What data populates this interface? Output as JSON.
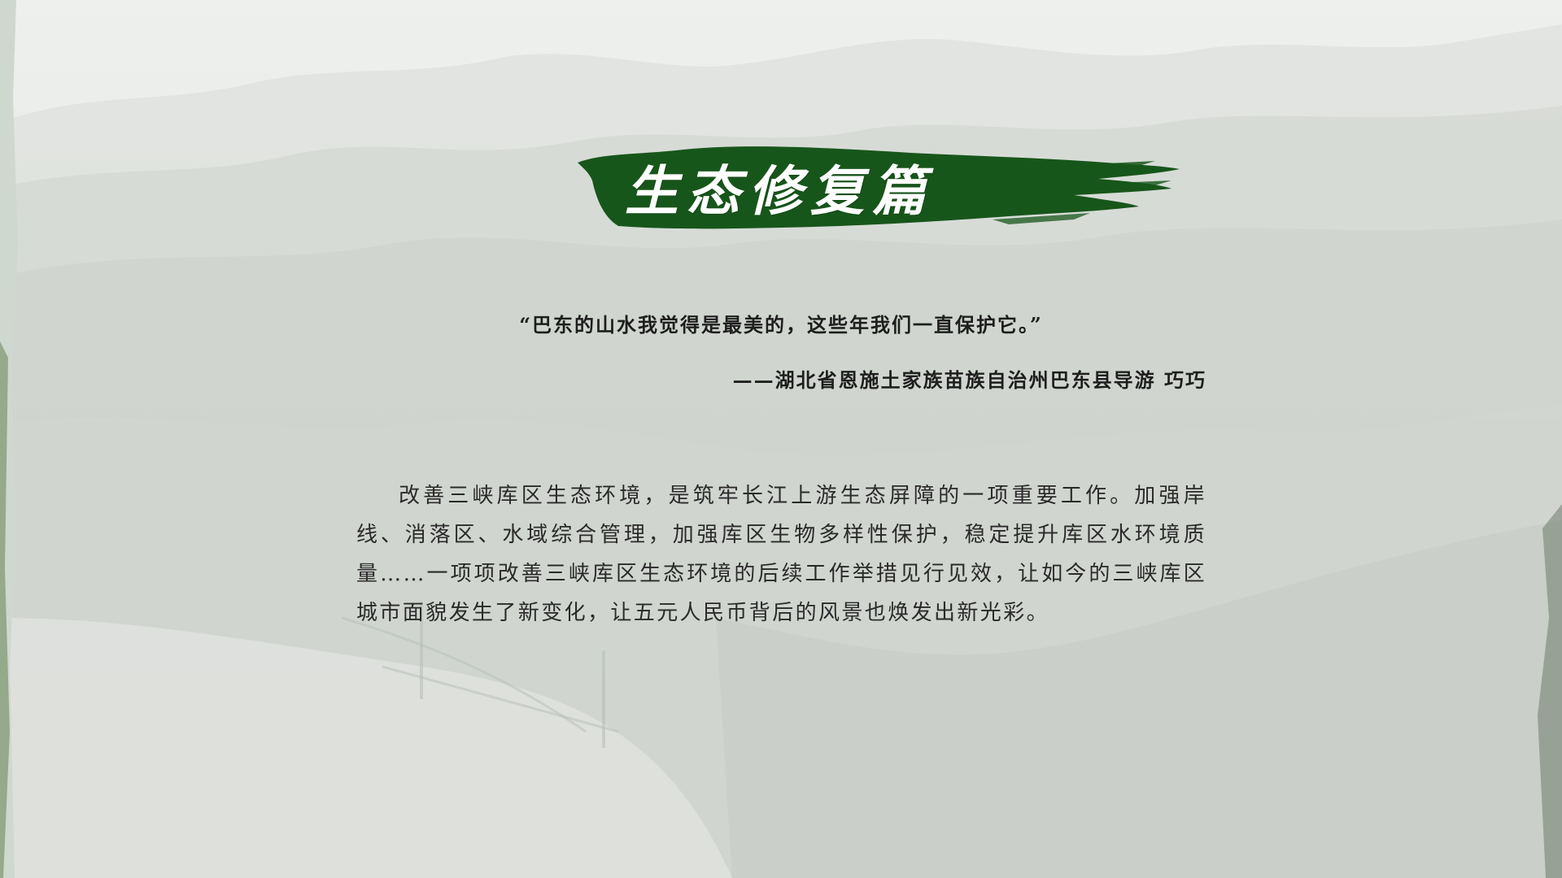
{
  "slide": {
    "title": "生态修复篇",
    "quote": "“巴东的山水我觉得是最美的，这些年我们一直保护它。”",
    "attribution": "——湖北省恩施土家族苗族自治州巴东县导游 巧巧",
    "body": "改善三峡库区生态环境，是筑牢长江上游生态屏障的一项重要工作。加强岸线、消落区、水域综合管理，加强库区生物多样性保护，稳定提升库区水环境质量……一项项改善三峡库区生态环境的后续工作举措见行见效，让如今的三峡库区城市面貌发生了新变化，让五元人民币背后的风景也焕发出新光彩。"
  },
  "colors": {
    "brush_green": "#17561a",
    "text_dark": "#1e1e1e",
    "background": "#e4e7e3"
  }
}
